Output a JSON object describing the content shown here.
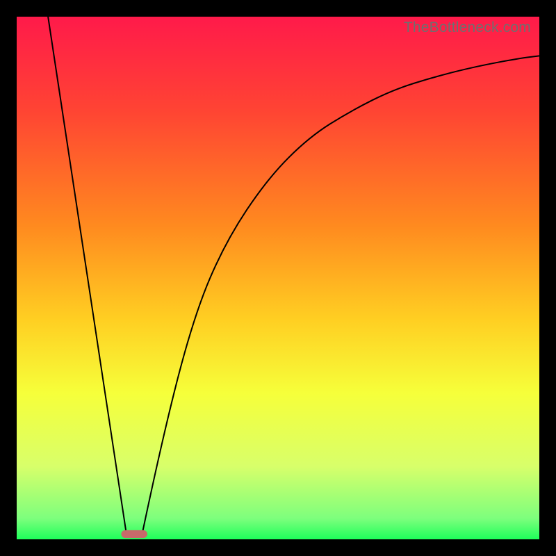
{
  "watermark": "TheBottleneck.com",
  "chart_data": {
    "type": "line",
    "title": "",
    "xlabel": "",
    "ylabel": "",
    "background": {
      "type": "vertical-gradient",
      "stops": [
        {
          "offset": 0.0,
          "color": "#ff1a4a"
        },
        {
          "offset": 0.18,
          "color": "#ff4433"
        },
        {
          "offset": 0.4,
          "color": "#ff8a1f"
        },
        {
          "offset": 0.58,
          "color": "#ffcf22"
        },
        {
          "offset": 0.72,
          "color": "#f6ff3a"
        },
        {
          "offset": 0.86,
          "color": "#d8ff6a"
        },
        {
          "offset": 0.96,
          "color": "#7dff7d"
        },
        {
          "offset": 1.0,
          "color": "#1eff5a"
        }
      ]
    },
    "xlim": [
      0,
      100
    ],
    "ylim": [
      0,
      100
    ],
    "series": [
      {
        "name": "curve-left",
        "description": "Straight descending segment from top-left down to the minimum",
        "x": [
          6,
          21
        ],
        "y": [
          100,
          1
        ]
      },
      {
        "name": "curve-right",
        "description": "Rising saturating curve from the minimum toward the upper right",
        "x": [
          24,
          28,
          34,
          40,
          48,
          56,
          64,
          72,
          80,
          88,
          96,
          100
        ],
        "y": [
          1,
          20,
          43,
          57,
          69,
          77,
          82,
          86,
          88.5,
          90.5,
          92,
          92.5
        ]
      }
    ],
    "marker": {
      "description": "Small rounded oval at the minimum point on the baseline",
      "x": 22.5,
      "y": 1,
      "width_pct": 5,
      "height_pct": 1.5,
      "color": "#c86a6a"
    }
  }
}
